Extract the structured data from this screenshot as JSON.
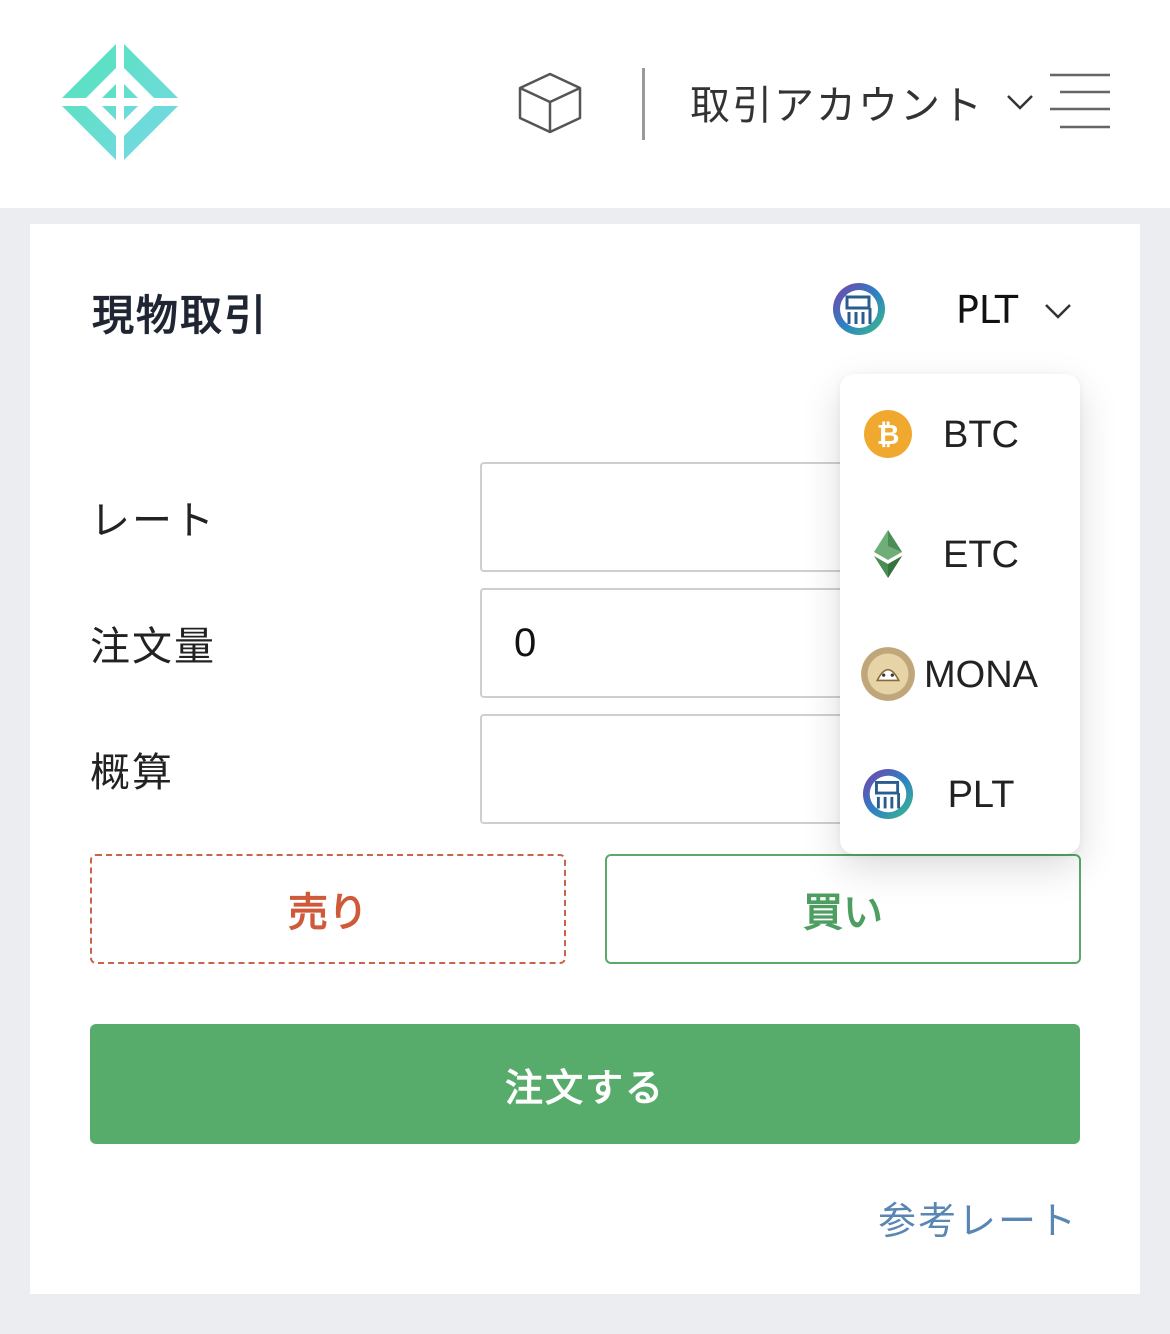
{
  "header": {
    "account_label": "取引アカウント"
  },
  "card": {
    "title": "現物取引",
    "selected_coin": "PLT"
  },
  "form": {
    "rate_label": "レート",
    "rate_value": "",
    "quantity_label": "注文量",
    "quantity_value": "0",
    "estimate_label": "概算",
    "estimate_value": ""
  },
  "actions": {
    "sell_label": "売り",
    "buy_label": "買い",
    "order_label": "注文する",
    "reference_rate_label": "参考レート"
  },
  "dropdown": {
    "items": [
      {
        "label": "BTC",
        "icon": "bitcoin-icon"
      },
      {
        "label": "ETC",
        "icon": "ethereum-classic-icon"
      },
      {
        "label": "MONA",
        "icon": "monacoin-icon"
      },
      {
        "label": "PLT",
        "icon": "palette-token-icon"
      }
    ]
  },
  "colors": {
    "accent_green": "#58ac6b",
    "sell_red": "#cf5a3a",
    "buy_green": "#4e9e62",
    "link_blue": "#5a86b4",
    "logo_teal": "#5fe3c0",
    "background": "#ecedf1"
  }
}
